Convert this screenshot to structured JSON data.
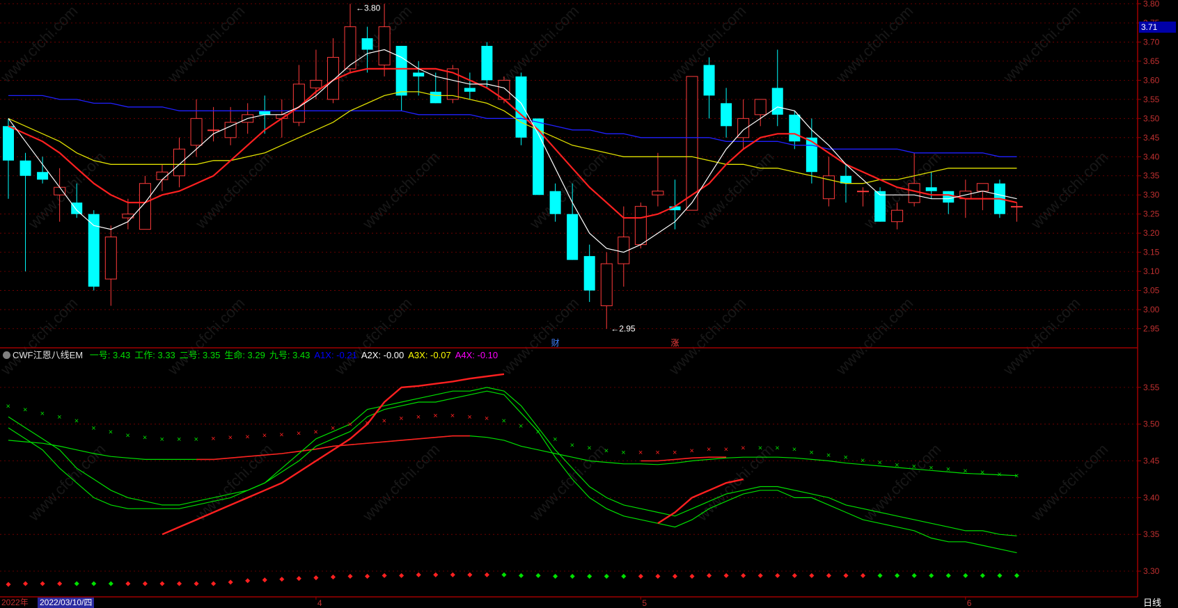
{
  "chart_data": {
    "type": "candlestick",
    "price_axis": {
      "ticks": [
        "3.80",
        "3.75",
        "3.70",
        "3.65",
        "3.60",
        "3.55",
        "3.50",
        "3.45",
        "3.40",
        "3.35",
        "3.30",
        "3.25",
        "3.20",
        "3.15",
        "3.10",
        "3.05",
        "3.00",
        "2.95"
      ],
      "tick_values": [
        3.8,
        3.75,
        3.7,
        3.65,
        3.6,
        3.55,
        3.5,
        3.45,
        3.4,
        3.35,
        3.3,
        3.25,
        3.2,
        3.15,
        3.1,
        3.05,
        3.0,
        2.95
      ],
      "ylim": [
        2.9,
        3.81
      ],
      "current_price": "3.71"
    },
    "annotations": {
      "high": "3.80",
      "low": "2.95"
    },
    "candles": [
      [
        3.48,
        3.5,
        3.29,
        3.39
      ],
      [
        3.39,
        3.41,
        3.1,
        3.35
      ],
      [
        3.36,
        3.4,
        3.33,
        3.34
      ],
      [
        3.3,
        3.37,
        3.23,
        3.32
      ],
      [
        3.28,
        3.33,
        3.24,
        3.25
      ],
      [
        3.25,
        3.26,
        3.05,
        3.06
      ],
      [
        3.08,
        3.22,
        3.01,
        3.19
      ],
      [
        3.24,
        3.29,
        3.21,
        3.25
      ],
      [
        3.21,
        3.35,
        3.21,
        3.33
      ],
      [
        3.34,
        3.38,
        3.31,
        3.36
      ],
      [
        3.35,
        3.45,
        3.32,
        3.42
      ],
      [
        3.43,
        3.55,
        3.4,
        3.5
      ],
      [
        3.47,
        3.53,
        3.44,
        3.47
      ],
      [
        3.45,
        3.53,
        3.43,
        3.49
      ],
      [
        3.49,
        3.54,
        3.46,
        3.51
      ],
      [
        3.52,
        3.56,
        3.46,
        3.51
      ],
      [
        3.5,
        3.55,
        3.45,
        3.51
      ],
      [
        3.49,
        3.64,
        3.48,
        3.59
      ],
      [
        3.58,
        3.68,
        3.55,
        3.6
      ],
      [
        3.55,
        3.71,
        3.54,
        3.66
      ],
      [
        3.63,
        3.8,
        3.62,
        3.74
      ],
      [
        3.71,
        3.74,
        3.62,
        3.68
      ],
      [
        3.64,
        3.8,
        3.61,
        3.74
      ],
      [
        3.69,
        3.69,
        3.52,
        3.56
      ],
      [
        3.62,
        3.65,
        3.56,
        3.61
      ],
      [
        3.57,
        3.62,
        3.54,
        3.54
      ],
      [
        3.55,
        3.64,
        3.54,
        3.63
      ],
      [
        3.58,
        3.62,
        3.55,
        3.57
      ],
      [
        3.69,
        3.7,
        3.58,
        3.6
      ],
      [
        3.55,
        3.61,
        3.54,
        3.6
      ],
      [
        3.61,
        3.62,
        3.43,
        3.45
      ],
      [
        3.5,
        3.5,
        3.3,
        3.3
      ],
      [
        3.31,
        3.33,
        3.23,
        3.25
      ],
      [
        3.25,
        3.33,
        3.13,
        3.13
      ],
      [
        3.14,
        3.17,
        3.02,
        3.05
      ],
      [
        3.01,
        3.15,
        2.95,
        3.12
      ],
      [
        3.12,
        3.27,
        3.06,
        3.19
      ],
      [
        3.17,
        3.28,
        3.16,
        3.27
      ],
      [
        3.3,
        3.41,
        3.27,
        3.31
      ],
      [
        3.27,
        3.34,
        3.21,
        3.26
      ],
      [
        3.26,
        3.61,
        3.26,
        3.61
      ],
      [
        3.64,
        3.66,
        3.5,
        3.56
      ],
      [
        3.54,
        3.58,
        3.45,
        3.48
      ],
      [
        3.45,
        3.55,
        3.42,
        3.5
      ],
      [
        3.51,
        3.54,
        3.48,
        3.55
      ],
      [
        3.58,
        3.68,
        3.48,
        3.51
      ],
      [
        3.51,
        3.52,
        3.42,
        3.44
      ],
      [
        3.45,
        3.5,
        3.33,
        3.36
      ],
      [
        3.29,
        3.4,
        3.27,
        3.35
      ],
      [
        3.35,
        3.38,
        3.28,
        3.33
      ],
      [
        3.31,
        3.32,
        3.27,
        3.31
      ],
      [
        3.31,
        3.32,
        3.23,
        3.23
      ],
      [
        3.23,
        3.28,
        3.21,
        3.26
      ],
      [
        3.28,
        3.41,
        3.27,
        3.33
      ],
      [
        3.32,
        3.36,
        3.29,
        3.31
      ],
      [
        3.31,
        3.31,
        3.25,
        3.28
      ],
      [
        3.29,
        3.34,
        3.24,
        3.31
      ],
      [
        3.31,
        3.32,
        3.26,
        3.33
      ],
      [
        3.33,
        3.34,
        3.24,
        3.25
      ],
      [
        3.27,
        3.28,
        3.23,
        3.27
      ]
    ],
    "ma_white": [
      3.5,
      3.44,
      3.38,
      3.32,
      3.26,
      3.22,
      3.21,
      3.23,
      3.28,
      3.34,
      3.38,
      3.42,
      3.46,
      3.48,
      3.5,
      3.51,
      3.51,
      3.53,
      3.56,
      3.6,
      3.64,
      3.67,
      3.68,
      3.66,
      3.63,
      3.61,
      3.6,
      3.59,
      3.59,
      3.58,
      3.54,
      3.46,
      3.37,
      3.28,
      3.2,
      3.16,
      3.15,
      3.17,
      3.2,
      3.23,
      3.28,
      3.35,
      3.42,
      3.47,
      3.5,
      3.53,
      3.52,
      3.47,
      3.43,
      3.38,
      3.34,
      3.3,
      3.3,
      3.3,
      3.29,
      3.29,
      3.3,
      3.31,
      3.3,
      3.29
    ],
    "ma_red": [
      3.48,
      3.46,
      3.44,
      3.41,
      3.37,
      3.33,
      3.3,
      3.28,
      3.28,
      3.3,
      3.31,
      3.33,
      3.35,
      3.39,
      3.43,
      3.47,
      3.5,
      3.53,
      3.57,
      3.6,
      3.62,
      3.63,
      3.63,
      3.63,
      3.63,
      3.63,
      3.62,
      3.6,
      3.58,
      3.55,
      3.51,
      3.47,
      3.42,
      3.37,
      3.32,
      3.28,
      3.24,
      3.24,
      3.25,
      3.27,
      3.3,
      3.33,
      3.38,
      3.42,
      3.45,
      3.46,
      3.46,
      3.44,
      3.41,
      3.38,
      3.36,
      3.34,
      3.32,
      3.31,
      3.3,
      3.3,
      3.29,
      3.29,
      3.29,
      3.28
    ],
    "ma_yellow": [
      3.5,
      3.48,
      3.46,
      3.44,
      3.41,
      3.39,
      3.38,
      3.38,
      3.38,
      3.38,
      3.38,
      3.38,
      3.39,
      3.39,
      3.4,
      3.41,
      3.43,
      3.45,
      3.47,
      3.49,
      3.52,
      3.54,
      3.56,
      3.57,
      3.57,
      3.56,
      3.56,
      3.55,
      3.54,
      3.52,
      3.49,
      3.47,
      3.45,
      3.43,
      3.42,
      3.41,
      3.4,
      3.4,
      3.4,
      3.4,
      3.4,
      3.39,
      3.38,
      3.38,
      3.37,
      3.37,
      3.36,
      3.35,
      3.34,
      3.33,
      3.33,
      3.34,
      3.34,
      3.35,
      3.36,
      3.37,
      3.37,
      3.37,
      3.37,
      3.37
    ],
    "ma_blue": [
      3.56,
      3.56,
      3.56,
      3.55,
      3.55,
      3.54,
      3.54,
      3.53,
      3.53,
      3.53,
      3.52,
      3.52,
      3.52,
      3.52,
      3.52,
      3.52,
      3.52,
      3.52,
      3.52,
      3.52,
      3.52,
      3.52,
      3.52,
      3.52,
      3.51,
      3.51,
      3.51,
      3.51,
      3.5,
      3.5,
      3.5,
      3.49,
      3.48,
      3.47,
      3.47,
      3.46,
      3.46,
      3.45,
      3.45,
      3.45,
      3.45,
      3.45,
      3.44,
      3.44,
      3.44,
      3.44,
      3.43,
      3.43,
      3.42,
      3.42,
      3.42,
      3.42,
      3.42,
      3.41,
      3.41,
      3.41,
      3.41,
      3.41,
      3.4,
      3.4
    ],
    "indicator": {
      "name": "CWF江恩八线EM",
      "legend": [
        {
          "label": "一号: 3.43",
          "color": "#00e000"
        },
        {
          "label": "工作: 3.33",
          "color": "#00e000"
        },
        {
          "label": "二号: 3.35",
          "color": "#00e000"
        },
        {
          "label": "生命: 3.29",
          "color": "#00e000"
        },
        {
          "label": "九号: 3.43",
          "color": "#00e000"
        },
        {
          "label": "A1X: -0.21",
          "color": "#0000ff"
        },
        {
          "label": "A2X: -0.00",
          "color": "#ffffff"
        },
        {
          "label": "A3X: -0.07",
          "color": "#ffff00"
        },
        {
          "label": "A4X: -0.10",
          "color": "#ff00ff"
        }
      ],
      "axis_ticks": [
        "3.55",
        "3.50",
        "3.45",
        "3.40",
        "3.35",
        "3.30"
      ],
      "tick_values": [
        3.55,
        3.5,
        3.45,
        3.4,
        3.35,
        3.3
      ],
      "ylim": [
        3.265,
        3.583
      ],
      "line_a": [
        3.51,
        3.495,
        3.48,
        3.465,
        3.44,
        3.425,
        3.41,
        3.4,
        3.395,
        3.39,
        3.39,
        3.395,
        3.4,
        3.405,
        3.41,
        3.42,
        3.435,
        3.45,
        3.47,
        3.48,
        3.49,
        3.51,
        3.52,
        3.525,
        3.53,
        3.53,
        3.535,
        3.54,
        3.545,
        3.54,
        3.515,
        3.49,
        3.455,
        3.425,
        3.4,
        3.385,
        3.375,
        3.37,
        3.365,
        3.36,
        3.37,
        3.385,
        3.395,
        3.405,
        3.41,
        3.41,
        3.4,
        3.4,
        3.39,
        3.38,
        3.37,
        3.365,
        3.36,
        3.355,
        3.345,
        3.34,
        3.34,
        3.335,
        3.33,
        3.325
      ],
      "line_b": [
        3.495,
        3.48,
        3.465,
        3.44,
        3.42,
        3.4,
        3.39,
        3.385,
        3.385,
        3.385,
        3.385,
        3.39,
        3.395,
        3.4,
        3.41,
        3.42,
        3.44,
        3.46,
        3.48,
        3.49,
        3.5,
        3.52,
        3.525,
        3.53,
        3.535,
        3.54,
        3.545,
        3.545,
        3.55,
        3.545,
        3.525,
        3.495,
        3.465,
        3.44,
        3.415,
        3.4,
        3.39,
        3.385,
        3.38,
        3.375,
        3.385,
        3.395,
        3.405,
        3.41,
        3.415,
        3.415,
        3.41,
        3.405,
        3.4,
        3.39,
        3.385,
        3.38,
        3.375,
        3.37,
        3.365,
        3.36,
        3.355,
        3.355,
        3.35,
        3.348
      ],
      "red_line": [
        null,
        null,
        null,
        null,
        null,
        null,
        null,
        null,
        null,
        3.35,
        3.36,
        3.37,
        3.38,
        3.39,
        3.4,
        3.41,
        3.42,
        3.435,
        3.45,
        3.465,
        3.48,
        3.5,
        3.53,
        3.55,
        3.552,
        3.555,
        3.558,
        3.562,
        3.565,
        3.568,
        null,
        null,
        null,
        null,
        null,
        null,
        null,
        null,
        3.365,
        3.38,
        3.4,
        3.41,
        3.42,
        3.425,
        null,
        null,
        null,
        null,
        null,
        null,
        null,
        null,
        null,
        null,
        null,
        null,
        null,
        null,
        null,
        null
      ],
      "line_c": [
        3.478,
        3.476,
        3.474,
        3.47,
        3.465,
        3.46,
        3.456,
        3.454,
        3.452,
        3.452,
        3.452,
        3.452,
        3.452,
        3.454,
        3.456,
        3.458,
        3.46,
        3.463,
        3.466,
        3.47,
        3.472,
        3.474,
        3.476,
        3.478,
        3.48,
        3.482,
        3.484,
        3.484,
        3.482,
        3.478,
        3.47,
        3.465,
        3.46,
        3.455,
        3.45,
        3.448,
        3.446,
        3.446,
        3.445,
        3.447,
        3.45,
        3.452,
        3.454,
        3.455,
        3.455,
        3.455,
        3.454,
        3.452,
        3.45,
        3.447,
        3.445,
        3.443,
        3.441,
        3.439,
        3.437,
        3.435,
        3.433,
        3.432,
        3.431,
        3.43
      ],
      "red_part_c": [
        null,
        null,
        null,
        null,
        null,
        null,
        null,
        null,
        null,
        null,
        null,
        3.452,
        3.452,
        3.454,
        3.456,
        3.458,
        3.46,
        3.463,
        3.466,
        3.47,
        3.472,
        3.474,
        3.476,
        3.478,
        3.48,
        3.482,
        3.484,
        3.484,
        null,
        null,
        null,
        null,
        null,
        null,
        null,
        null,
        null,
        3.45,
        3.45,
        3.452,
        3.454,
        3.455,
        3.455,
        null,
        null,
        null,
        null,
        null,
        null,
        null,
        null,
        null,
        null,
        null,
        null,
        null,
        null,
        null,
        null,
        null
      ],
      "x_markers": [
        3.525,
        3.52,
        3.515,
        3.51,
        3.505,
        3.495,
        3.49,
        3.485,
        3.482,
        3.48,
        3.48,
        3.48,
        3.481,
        3.482,
        3.483,
        3.485,
        3.486,
        3.488,
        3.49,
        3.495,
        3.5,
        3.502,
        3.505,
        3.508,
        3.51,
        3.512,
        3.512,
        3.51,
        3.508,
        3.505,
        3.498,
        3.49,
        3.48,
        3.472,
        3.468,
        3.464,
        3.462,
        3.462,
        3.462,
        3.462,
        3.464,
        3.466,
        3.466,
        3.468,
        3.468,
        3.468,
        3.466,
        3.462,
        3.458,
        3.455,
        3.451,
        3.448,
        3.445,
        3.443,
        3.441,
        3.439,
        3.437,
        3.435,
        3.432,
        3.43
      ],
      "x_marker_colors": [
        "g",
        "g",
        "g",
        "g",
        "g",
        "g",
        "g",
        "g",
        "g",
        "g",
        "g",
        "g",
        "r",
        "r",
        "r",
        "r",
        "r",
        "r",
        "r",
        "r",
        "r",
        "r",
        "r",
        "r",
        "r",
        "r",
        "r",
        "r",
        "r",
        "g",
        "g",
        "g",
        "g",
        "g",
        "g",
        "g",
        "g",
        "r",
        "r",
        "r",
        "r",
        "r",
        "r",
        "r",
        "g",
        "g",
        "g",
        "g",
        "g",
        "g",
        "g",
        "g",
        "g",
        "g",
        "g",
        "g",
        "g",
        "g",
        "g",
        "g"
      ],
      "dots": [
        3.282,
        3.283,
        3.283,
        3.283,
        3.283,
        3.283,
        3.283,
        3.283,
        3.283,
        3.283,
        3.283,
        3.283,
        3.283,
        3.285,
        3.287,
        3.288,
        3.289,
        3.29,
        3.291,
        3.292,
        3.293,
        3.293,
        3.294,
        3.294,
        3.295,
        3.295,
        3.295,
        3.295,
        3.295,
        3.295,
        3.294,
        3.294,
        3.293,
        3.293,
        3.293,
        3.293,
        3.293,
        3.293,
        3.293,
        3.293,
        3.293,
        3.294,
        3.294,
        3.294,
        3.294,
        3.294,
        3.294,
        3.294,
        3.294,
        3.294,
        3.294,
        3.294,
        3.294,
        3.294,
        3.294,
        3.294,
        3.294,
        3.294,
        3.294,
        3.294
      ],
      "dot_colors": [
        "r",
        "r",
        "r",
        "r",
        "g",
        "g",
        "g",
        "r",
        "r",
        "r",
        "r",
        "r",
        "r",
        "r",
        "r",
        "r",
        "r",
        "r",
        "r",
        "r",
        "r",
        "r",
        "r",
        "r",
        "r",
        "r",
        "r",
        "r",
        "r",
        "g",
        "g",
        "g",
        "g",
        "g",
        "g",
        "g",
        "g",
        "r",
        "r",
        "r",
        "r",
        "r",
        "r",
        "r",
        "r",
        "r",
        "r",
        "r",
        "r",
        "r",
        "r",
        "g",
        "g",
        "g",
        "g",
        "g",
        "g",
        "g",
        "g",
        "g"
      ]
    },
    "x_axis": {
      "year_label": "2022年",
      "cursor_date": "2022/03/10/四",
      "month_labels": [
        {
          "label": "4",
          "index": 18
        },
        {
          "label": "5",
          "index": 37
        },
        {
          "label": "6",
          "index": 56
        }
      ]
    },
    "events": [
      {
        "label": "财",
        "index": 32
      },
      {
        "label": "涨",
        "index": 39
      }
    ],
    "period": "日线",
    "watermark": "www.cfchi.com",
    "colors": {
      "up": "#ff3b3b",
      "down": "#00ffff",
      "ma_white": "#ffffff",
      "ma_red": "#ff2020",
      "ma_yellow": "#e0e000",
      "ma_blue": "#2020ff",
      "grid": "#800000",
      "axis_text": "#c03030",
      "ind_green": "#00e000",
      "ind_red": "#ff2020"
    }
  }
}
